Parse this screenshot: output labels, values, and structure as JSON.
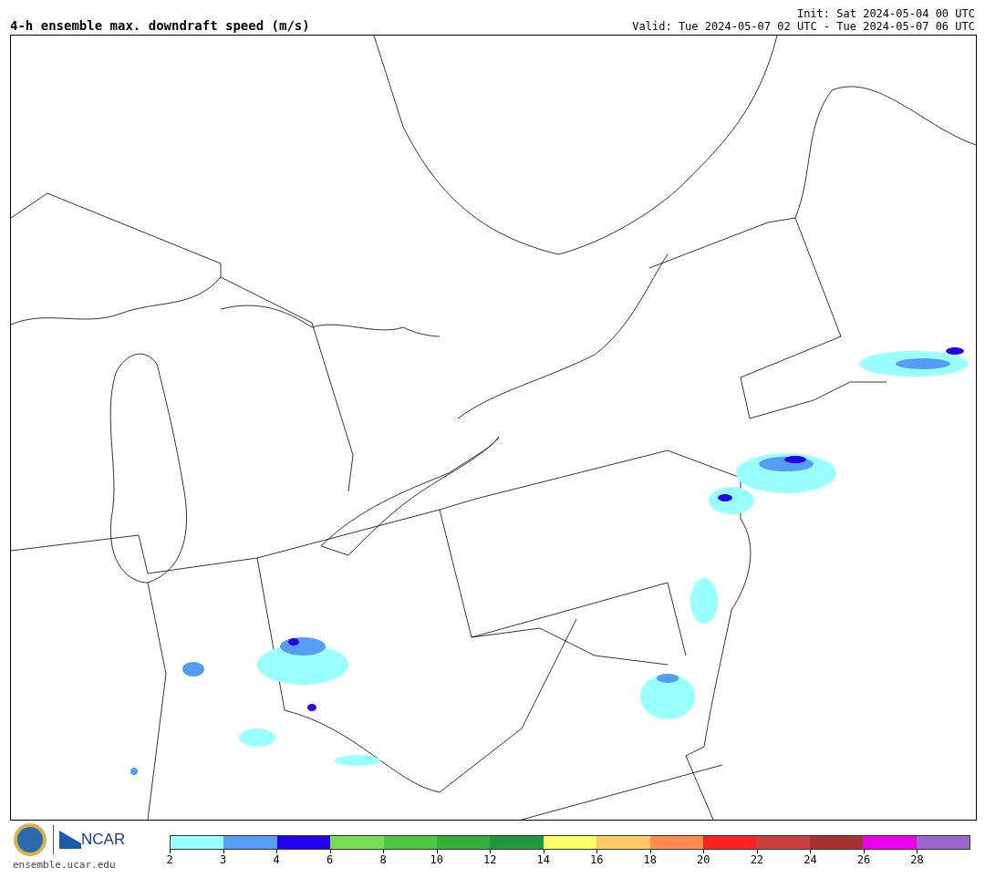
{
  "title": "4-h ensemble max. downdraft speed (m/s)",
  "init": "Init: Sat 2024-05-04 00 UTC",
  "valid": "Valid: Tue 2024-05-07 02 UTC - Tue 2024-05-07 06 UTC",
  "logo": {
    "text": "NCAR",
    "url": "ensemble.ucar.edu"
  },
  "colorbar": [
    {
      "label": "2",
      "color": "#99ffff"
    },
    {
      "label": "3",
      "color": "#559cf5"
    },
    {
      "label": "4",
      "color": "#2000ee"
    },
    {
      "label": "6",
      "color": "#78dd55"
    },
    {
      "label": "8",
      "color": "#4cc844"
    },
    {
      "label": "10",
      "color": "#33b038"
    },
    {
      "label": "12",
      "color": "#209840"
    },
    {
      "label": "14",
      "color": "#ffff66"
    },
    {
      "label": "16",
      "color": "#ffc966"
    },
    {
      "label": "18",
      "color": "#ff8c50"
    },
    {
      "label": "20",
      "color": "#ff2020"
    },
    {
      "label": "22",
      "color": "#cc4040"
    },
    {
      "label": "24",
      "color": "#a83232"
    },
    {
      "label": "26",
      "color": "#ee00ee"
    },
    {
      "label": "28",
      "color": "#9966cc"
    }
  ]
}
